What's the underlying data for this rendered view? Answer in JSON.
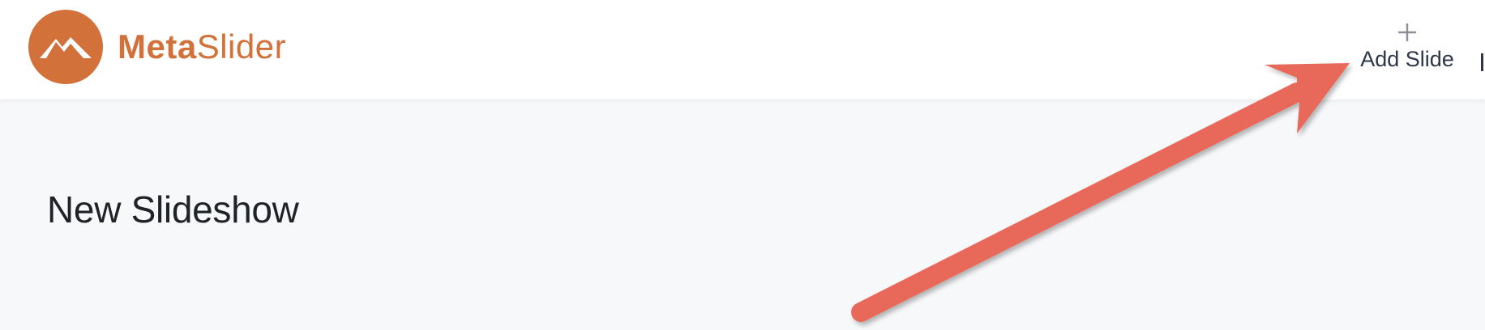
{
  "brand": {
    "name_bold": "Meta",
    "name_light": "Slider",
    "color": "#d2713a"
  },
  "toolbar": {
    "add_slide_label": "Add Slide",
    "add_slide_icon": "plus-icon"
  },
  "main": {
    "title": "New Slideshow"
  },
  "annotation": {
    "arrow_color": "#e8685a"
  }
}
